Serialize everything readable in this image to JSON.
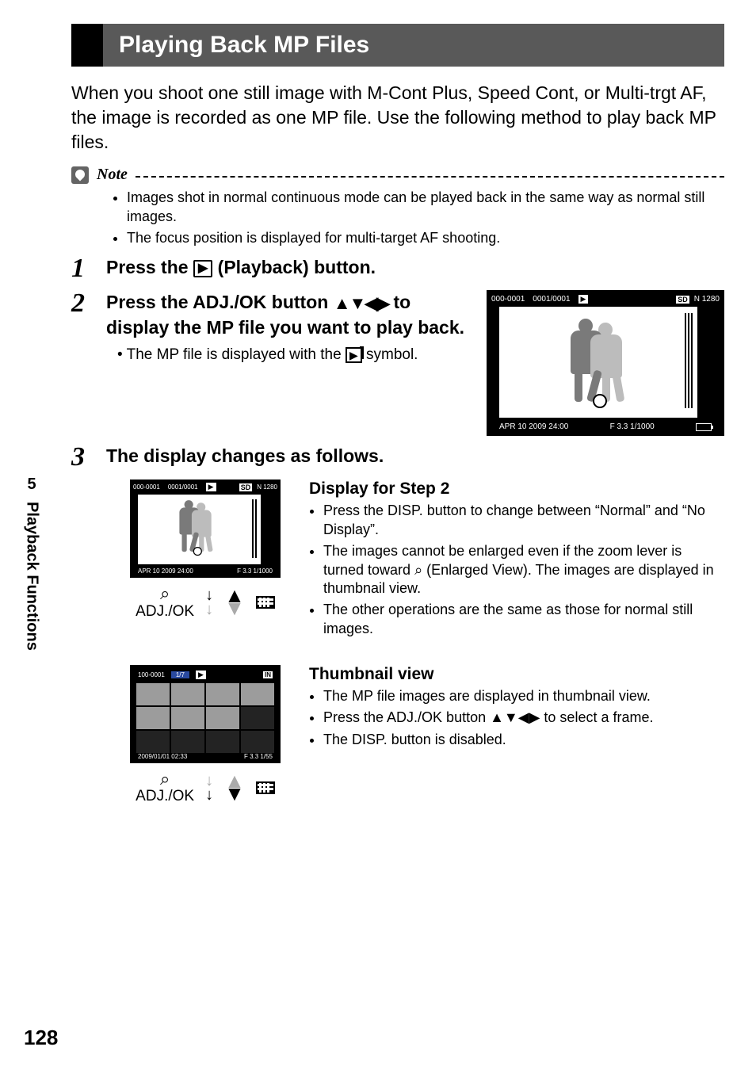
{
  "page_number": "128",
  "chapter_number": "5",
  "side_label": "Playback Functions",
  "title": "Playing Back MP Files",
  "intro": "When you shoot one still image with M-Cont Plus, Speed Cont, or Multi-trgt AF, the image is recorded as one MP file. Use the following method to play back MP files.",
  "note_label": "Note",
  "note_items": [
    "Images shot in normal continuous mode can be played back in the same way as normal still images.",
    "The focus position is displayed for multi-target AF shooting."
  ],
  "step1": {
    "num": "1",
    "pre": "Press the ",
    "post": " (Playback) button."
  },
  "step2": {
    "num": "2",
    "line1_pre": "Press the ADJ./OK button ",
    "line1_post": " to display the MP file you want to play back.",
    "bullet_pre": "The MP file is displayed with the ",
    "bullet_post": " symbol."
  },
  "step3": {
    "num": "3",
    "head": "The display changes as follows."
  },
  "adj_label": "ADJ./OK",
  "fig_large": {
    "folder": "000-0001",
    "counter": "0001/0001",
    "sd": "SD",
    "quality": "N 1280",
    "date": "APR 10 2009 24:00",
    "exposure": "F 3.3 1/1000"
  },
  "fig_small": {
    "folder": "000-0001",
    "counter": "0001/0001",
    "sd": "SD",
    "quality": "N 1280",
    "date": "APR 10 2009 24:00",
    "exposure": "F 3.3 1/1000"
  },
  "fig_grid": {
    "folder": "100-0001",
    "counter": "1/7",
    "in": "IN",
    "date": "2009/01/01 02:33",
    "exposure": "F 3.3 1/55"
  },
  "desc1": {
    "head": "Display for Step 2",
    "items": [
      "Press the DISP. button to change between “Normal” and “No Display”.",
      "The images cannot be enlarged even if the zoom lever is turned toward ⌕ (Enlarged View). The images are displayed in thumbnail view.",
      "The other operations are the same as those for normal still images."
    ]
  },
  "desc2": {
    "head": "Thumbnail view",
    "items": [
      "The MP file images are displayed in thumbnail view.",
      "Press the ADJ./OK button ▲▼◀▶ to select a frame.",
      "The DISP. button is disabled."
    ]
  }
}
